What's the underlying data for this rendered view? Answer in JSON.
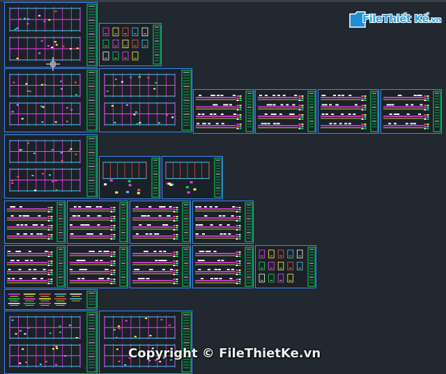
{
  "watermark": {
    "logo_main": "File",
    "logo_brand": "Thiết Kế",
    "logo_domain": ".vn",
    "copyright": "Copyright © FileThietKe.vn"
  },
  "colors": {
    "background": "#212830",
    "sheet_border": "#3a8cff",
    "title_block": "#00e05a",
    "wall": "#ff40ff",
    "grid": "#4ad0ff",
    "annotation": "#ffff40",
    "rebar": "#ff5050",
    "text_white": "#ffffff",
    "logo_blue": "#2aa7e8"
  }
}
